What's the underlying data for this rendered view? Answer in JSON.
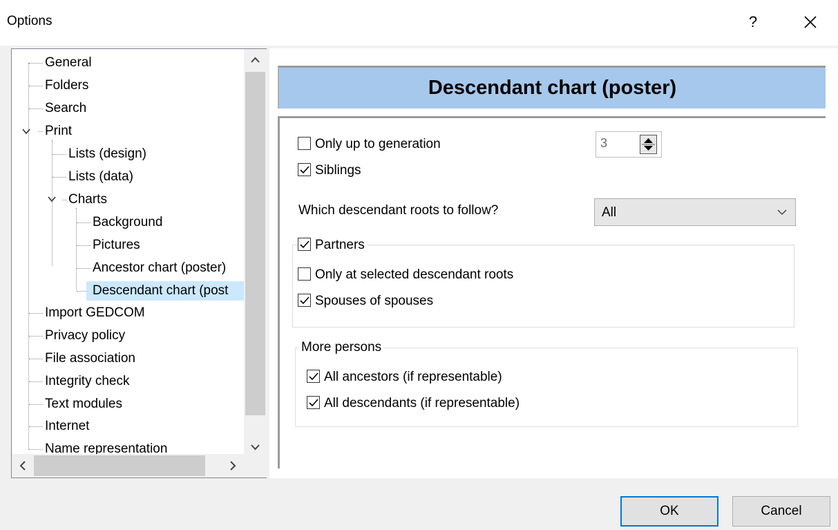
{
  "window": {
    "title": "Options",
    "help_glyph": "?",
    "close_glyph": "✕"
  },
  "tree": {
    "items": [
      {
        "label": "General"
      },
      {
        "label": "Folders"
      },
      {
        "label": "Search"
      },
      {
        "label": "Print"
      },
      {
        "label": "Lists (design)"
      },
      {
        "label": "Lists (data)"
      },
      {
        "label": "Charts"
      },
      {
        "label": "Background"
      },
      {
        "label": "Pictures"
      },
      {
        "label": "Ancestor chart (poster)"
      },
      {
        "label": "Descendant chart (post"
      },
      {
        "label": "Import GEDCOM"
      },
      {
        "label": "Privacy policy"
      },
      {
        "label": "File association"
      },
      {
        "label": "Integrity check"
      },
      {
        "label": "Text modules"
      },
      {
        "label": "Internet"
      },
      {
        "label": "Name representation"
      }
    ],
    "selected_index": 10
  },
  "panel": {
    "header": "Descendant chart (poster)",
    "only_up_to_generation": {
      "label": "Only up to generation",
      "checked": false,
      "value": "3"
    },
    "siblings": {
      "label": "Siblings",
      "checked": true
    },
    "roots": {
      "label": "Which descendant roots to follow?",
      "selected": "All"
    },
    "partners": {
      "label": "Partners",
      "checked": true,
      "only_selected": {
        "label": "Only at selected descendant roots",
        "checked": false
      },
      "spouses_of_spouses": {
        "label": "Spouses of spouses",
        "checked": true
      }
    },
    "more_persons": {
      "label": "More persons",
      "all_ancestors": {
        "label": "All ancestors (if representable)",
        "checked": true
      },
      "all_descendants": {
        "label": "All descendants (if representable)",
        "checked": true
      }
    }
  },
  "buttons": {
    "ok": "OK",
    "cancel": "Cancel"
  },
  "colors": {
    "header_bg": "#a6c8ec",
    "selection_bg": "#cce8ff",
    "default_button_border": "#0078d7"
  }
}
